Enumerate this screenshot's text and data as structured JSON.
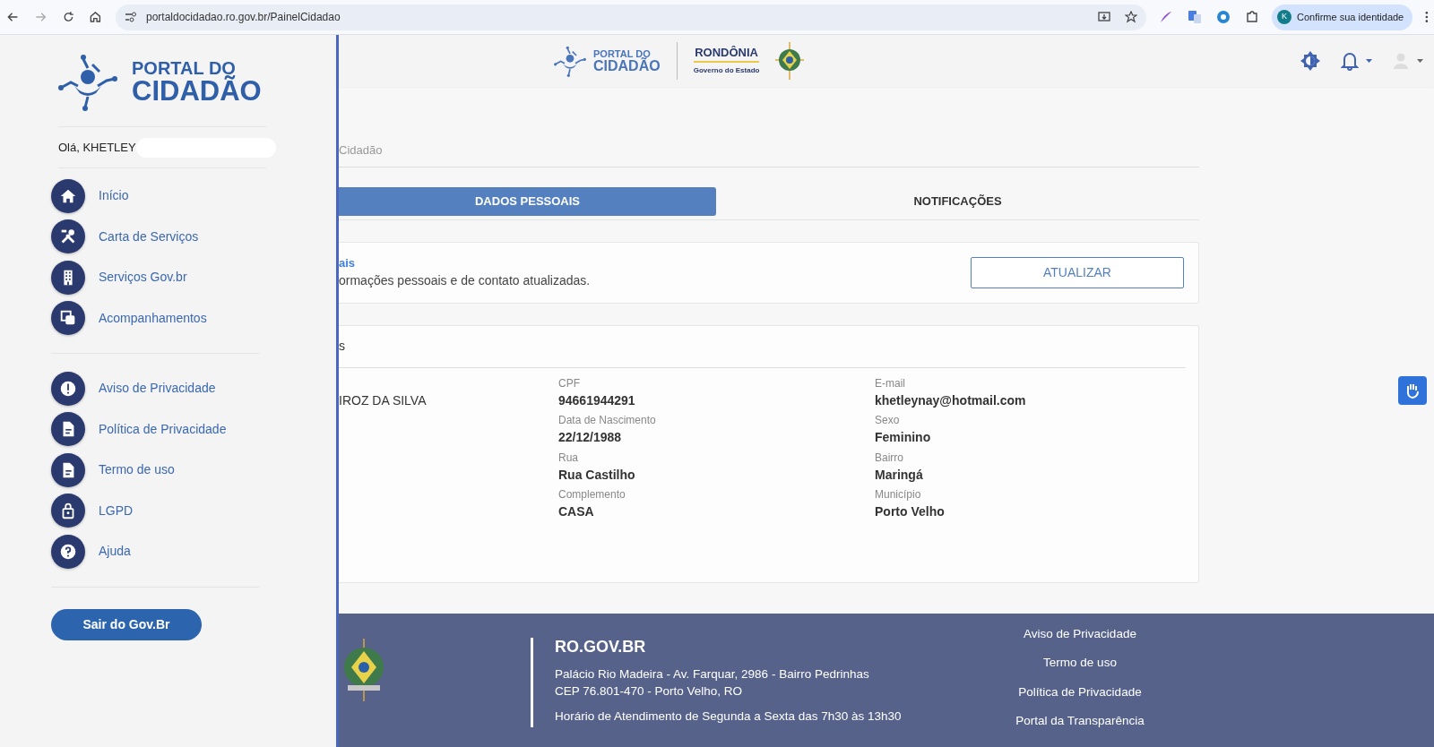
{
  "browser": {
    "url": "portaldocidadao.ro.gov.br/PainelCidadao",
    "profile_button": "Confirme sua identidade",
    "profile_initial": "K"
  },
  "sidebar": {
    "logo": {
      "line1": "PORTAL DO",
      "line2": "CIDADÃO"
    },
    "greeting": "Olá, KHETLEY",
    "menu": [
      {
        "label": "Início",
        "kind": "home"
      },
      {
        "label": "Carta de Serviços",
        "kind": "tools"
      },
      {
        "label": "Serviços Gov.br",
        "kind": "building"
      },
      {
        "label": "Acompanhamentos",
        "kind": "copies"
      }
    ],
    "legal_menu": [
      {
        "label": "Aviso de Privacidade",
        "kind": "alert"
      },
      {
        "label": "Política de Privacidade",
        "kind": "doc"
      },
      {
        "label": "Termo de uso",
        "kind": "doc"
      },
      {
        "label": "LGPD",
        "kind": "lock"
      },
      {
        "label": "Ajuda",
        "kind": "help"
      }
    ],
    "logout": "Sair do Gov.Br"
  },
  "header": {
    "portal_line1": "PORTAL DO",
    "portal_line2": "CIDADÃO",
    "state_name": "RONDÔNIA",
    "state_sub": "Governo do Estado"
  },
  "breadcrumb": "Cidadão",
  "tabs": [
    {
      "label": "DADOS PESSOAIS",
      "selected": true
    },
    {
      "label": "NOTIFICAÇÕES",
      "selected": false
    }
  ],
  "update_card": {
    "title": "ais",
    "text": "ormações pessoais e de contato atualizadas.",
    "button": "ATUALIZAR"
  },
  "data_card": {
    "title": "s",
    "columns": [
      [
        {
          "value": "IROZ DA SILVA"
        }
      ],
      [
        {
          "label": "CPF",
          "value": "94661944291"
        },
        {
          "label": "Data de Nascimento",
          "value": "22/12/1988"
        },
        {
          "label": "Rua",
          "value": "Rua Castilho"
        },
        {
          "label": "Complemento",
          "value": "CASA"
        }
      ],
      [
        {
          "label": "E-mail",
          "value": "khetleynay@hotmail.com"
        },
        {
          "label": "Sexo",
          "value": "Feminino"
        },
        {
          "label": "Bairro",
          "value": "Maringá"
        },
        {
          "label": "Município",
          "value": "Porto Velho"
        }
      ]
    ]
  },
  "footer": {
    "title": "RO.GOV.BR",
    "address": [
      "Palácio Rio Madeira - Av. Farquar, 2986 - Bairro Pedrinhas",
      "CEP 76.801-470 - Porto Velho, RO"
    ],
    "hours": "Horário de Atendimento de Segunda a Sexta das 7h30 às 13h30",
    "links": [
      "Aviso de Privacidade",
      "Termo de uso",
      "Política de Privacidade",
      "Portal da Transparência"
    ]
  }
}
